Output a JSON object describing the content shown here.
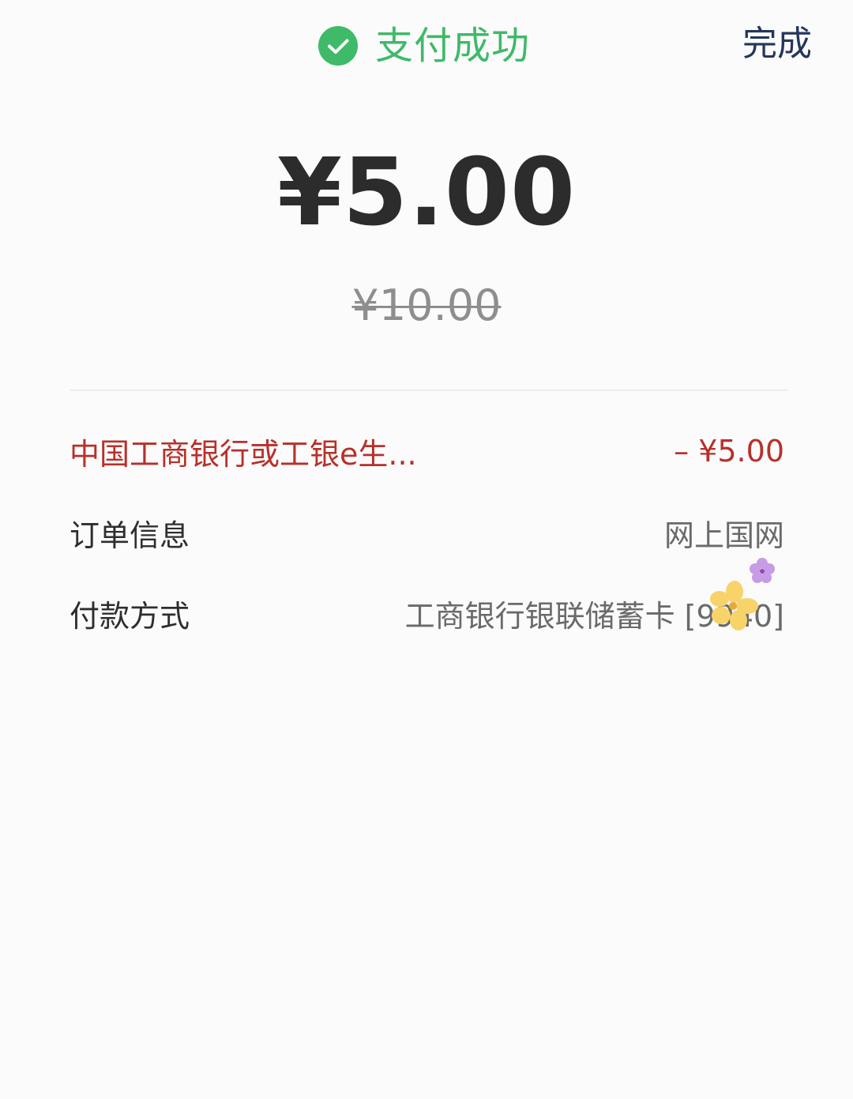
{
  "header": {
    "status_icon": "check-circle-icon",
    "status_text": "支付成功",
    "done_label": "完成"
  },
  "payment": {
    "amount": "¥5.00",
    "original_amount": "¥10.00"
  },
  "details": {
    "discount_label": "中国工商银行或工银e生...",
    "discount_value": "– ¥5.00",
    "order_label": "订单信息",
    "order_value": "网上国网",
    "method_label": "付款方式",
    "method_value": "工商银行银联储蓄卡 [9940]"
  },
  "colors": {
    "success": "#3fba68",
    "discount": "#b8302a",
    "done": "#24365e"
  }
}
